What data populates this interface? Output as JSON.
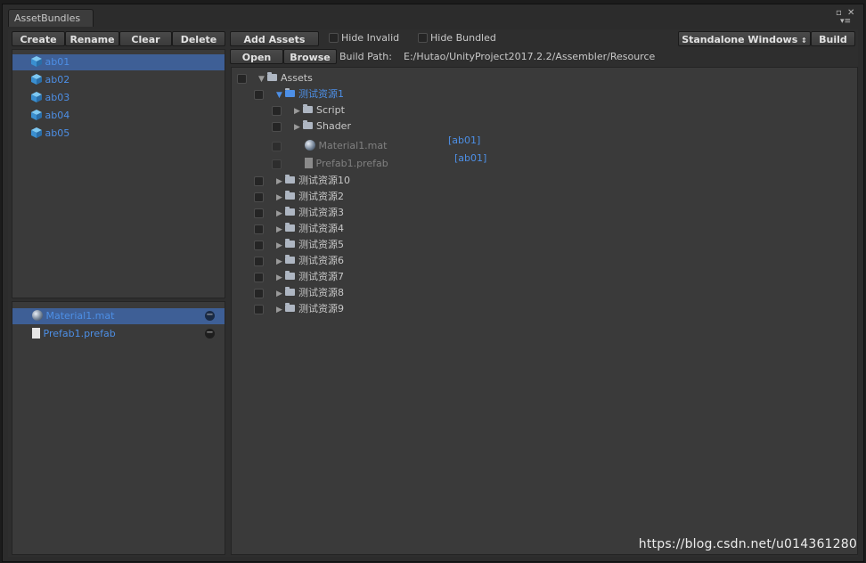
{
  "window": {
    "tab_title": "AssetBundles",
    "controls_maximize": "▫",
    "controls_close": "✕",
    "controls_menu": "▾≡"
  },
  "toolbar": {
    "create": "Create",
    "rename": "Rename",
    "clear": "Clear",
    "delete": "Delete",
    "add_assets": "Add Assets",
    "hide_invalid": "Hide Invalid",
    "hide_bundled": "Hide Bundled",
    "platform": "Standalone Windows",
    "build": "Build",
    "open": "Open",
    "browse": "Browse",
    "build_path_label": "Build Path:",
    "build_path_value": "E:/Hutao/UnityProject2017.2.2/Assembler/Resource"
  },
  "bundles": [
    {
      "label": "ab01",
      "selected": true
    },
    {
      "label": "ab02"
    },
    {
      "label": "ab03"
    },
    {
      "label": "ab04"
    },
    {
      "label": "ab05"
    }
  ],
  "bundle_assets": [
    {
      "label": "Material1.mat",
      "icon": "material-sphere-icon",
      "selected": true
    },
    {
      "label": "Prefab1.prefab",
      "icon": "document-icon"
    }
  ],
  "tree": [
    {
      "label": "Assets",
      "depth": 0,
      "arrow": "▼"
    },
    {
      "label": "测试资源1",
      "depth": 1,
      "arrow": "▼",
      "open": true
    },
    {
      "label": "Script",
      "depth": 2,
      "arrow": "▶"
    },
    {
      "label": "Shader",
      "depth": 2,
      "arrow": "▶"
    },
    {
      "label": "Material1.mat",
      "depth": 2,
      "kind": "material",
      "tag": "[ab01]"
    },
    {
      "label": "Prefab1.prefab",
      "depth": 2,
      "kind": "prefab",
      "tag": "[ab01]"
    },
    {
      "label": "测试资源10",
      "depth": 1,
      "arrow": "▶"
    },
    {
      "label": "测试资源2",
      "depth": 1,
      "arrow": "▶"
    },
    {
      "label": "测试资源3",
      "depth": 1,
      "arrow": "▶"
    },
    {
      "label": "测试资源4",
      "depth": 1,
      "arrow": "▶"
    },
    {
      "label": "测试资源5",
      "depth": 1,
      "arrow": "▶"
    },
    {
      "label": "测试资源6",
      "depth": 1,
      "arrow": "▶"
    },
    {
      "label": "测试资源7",
      "depth": 1,
      "arrow": "▶"
    },
    {
      "label": "测试资源8",
      "depth": 1,
      "arrow": "▶"
    },
    {
      "label": "测试资源9",
      "depth": 1,
      "arrow": "▶"
    }
  ],
  "watermark": "https://blog.csdn.net/u014361280",
  "colors": {
    "accent": "#4d8fe6",
    "selection": "#3e5f96",
    "background": "#2e2e2e"
  }
}
